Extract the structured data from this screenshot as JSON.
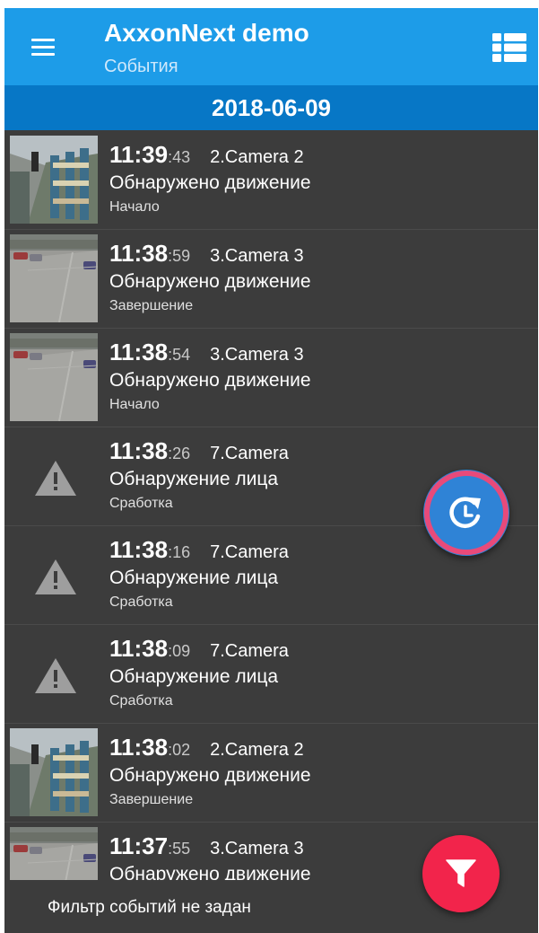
{
  "appbar": {
    "title": "AxxonNext demo",
    "subtitle": "События",
    "menu_icon": "menu-icon",
    "view_icon": "list-view-icon"
  },
  "date_header": "2018-06-09",
  "events": [
    {
      "hm": "11:39",
      "sec": ":43",
      "camera": "2.Camera 2",
      "type": "Обнаружено движение",
      "phase": "Начало",
      "thumb": "warehouse"
    },
    {
      "hm": "11:38",
      "sec": ":59",
      "camera": "3.Camera 3",
      "type": "Обнаружено движение",
      "phase": "Завершение",
      "thumb": "parking"
    },
    {
      "hm": "11:38",
      "sec": ":54",
      "camera": "3.Camera 3",
      "type": "Обнаружено движение",
      "phase": "Начало",
      "thumb": "parking"
    },
    {
      "hm": "11:38",
      "sec": ":26",
      "camera": "7.Camera",
      "type": "Обнаружение лица",
      "phase": "Сработка",
      "thumb": "warning"
    },
    {
      "hm": "11:38",
      "sec": ":16",
      "camera": "7.Camera",
      "type": "Обнаружение лица",
      "phase": "Сработка",
      "thumb": "warning"
    },
    {
      "hm": "11:38",
      "sec": ":09",
      "camera": "7.Camera",
      "type": "Обнаружение лица",
      "phase": "Сработка",
      "thumb": "warning"
    },
    {
      "hm": "11:38",
      "sec": ":02",
      "camera": "2.Camera 2",
      "type": "Обнаружено движение",
      "phase": "Завершение",
      "thumb": "warehouse"
    },
    {
      "hm": "11:37",
      "sec": ":55",
      "camera": "3.Camera 3",
      "type": "Обнаружено движение",
      "phase": "",
      "thumb": "parking"
    }
  ],
  "footer": {
    "filter_status": "Фильтр событий не задан"
  },
  "fab": {
    "refresh_icon": "refresh-clock-icon",
    "filter_icon": "filter-icon"
  },
  "colors": {
    "appbar": "#1d9ce8",
    "date_bar": "#0777c6",
    "list_bg": "#3c3c3c",
    "fab_refresh": "#2f83d6",
    "fab_ring": "#e84a7a",
    "fab_filter": "#f2244b"
  }
}
